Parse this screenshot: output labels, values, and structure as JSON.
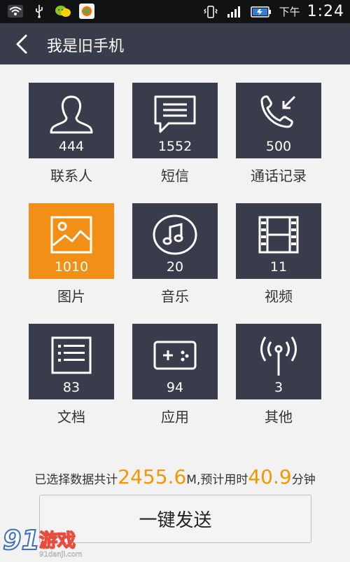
{
  "status_bar": {
    "ampm": "下午",
    "time": "1:24",
    "icons": [
      "wifi-icon",
      "usb-icon",
      "wechat-icon",
      "app-icon",
      "vibrate-icon",
      "signal-icon",
      "battery-icon"
    ]
  },
  "header": {
    "title": "我是旧手机"
  },
  "grid": [
    {
      "label": "联系人",
      "count": "444",
      "icon": "contact-icon",
      "active": false
    },
    {
      "label": "短信",
      "count": "1552",
      "icon": "message-icon",
      "active": false
    },
    {
      "label": "通话记录",
      "count": "500",
      "icon": "phone-icon",
      "active": false
    },
    {
      "label": "图片",
      "count": "1010",
      "icon": "image-icon",
      "active": true
    },
    {
      "label": "音乐",
      "count": "20",
      "icon": "music-icon",
      "active": false
    },
    {
      "label": "视频",
      "count": "11",
      "icon": "video-icon",
      "active": false
    },
    {
      "label": "文档",
      "count": "83",
      "icon": "document-icon",
      "active": false
    },
    {
      "label": "应用",
      "count": "94",
      "icon": "app-gamepad-icon",
      "active": false
    },
    {
      "label": "其他",
      "count": "3",
      "icon": "other-antenna-icon",
      "active": false
    }
  ],
  "summary": {
    "prefix": "已选择数据共计",
    "size": "2455.6",
    "size_unit": "M,预计用时",
    "time": "40.9",
    "time_unit": "分钟"
  },
  "send_button": {
    "label": "一键发送"
  },
  "watermark": {
    "logo_text": "91游戏",
    "site": "91danji.com"
  },
  "colors": {
    "tile": "#393c4a",
    "tile_active": "#f18f16",
    "accent": "#f39800"
  }
}
